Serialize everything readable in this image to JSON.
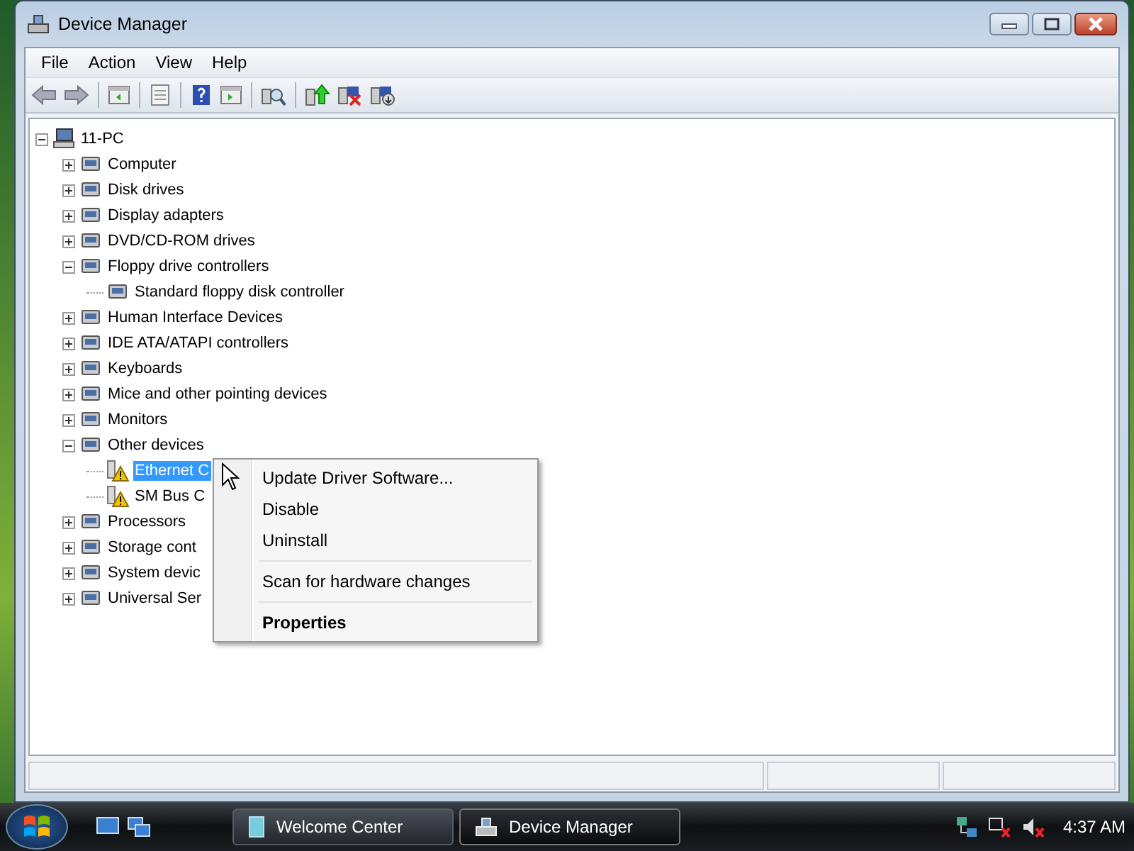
{
  "window": {
    "title": "Device Manager"
  },
  "menubar": [
    "File",
    "Action",
    "View",
    "Help"
  ],
  "tree": {
    "label": "11-PC",
    "expanded": true,
    "selected": false,
    "problem": false,
    "children": [
      {
        "label": "Computer",
        "expanded": false,
        "selected": false,
        "problem": false
      },
      {
        "label": "Disk drives",
        "expanded": false,
        "selected": false,
        "problem": false
      },
      {
        "label": "Display adapters",
        "expanded": false,
        "selected": false,
        "problem": false
      },
      {
        "label": "DVD/CD-ROM drives",
        "expanded": false,
        "selected": false,
        "problem": false
      },
      {
        "label": "Floppy drive controllers",
        "expanded": true,
        "selected": false,
        "problem": false,
        "children": [
          {
            "label": "Standard floppy disk controller",
            "selected": false,
            "problem": false
          }
        ]
      },
      {
        "label": "Human Interface Devices",
        "expanded": false,
        "selected": false,
        "problem": false
      },
      {
        "label": "IDE ATA/ATAPI controllers",
        "expanded": false,
        "selected": false,
        "problem": false
      },
      {
        "label": "Keyboards",
        "expanded": false,
        "selected": false,
        "problem": false
      },
      {
        "label": "Mice and other pointing devices",
        "expanded": false,
        "selected": false,
        "problem": false
      },
      {
        "label": "Monitors",
        "expanded": false,
        "selected": false,
        "problem": false
      },
      {
        "label": "Other devices",
        "expanded": true,
        "selected": false,
        "problem": false,
        "children": [
          {
            "label": "Ethernet C",
            "selected": true,
            "problem": true
          },
          {
            "label": "SM Bus C",
            "selected": false,
            "problem": true
          }
        ]
      },
      {
        "label": "Processors",
        "expanded": false,
        "selected": false,
        "problem": false
      },
      {
        "label": "Storage cont",
        "expanded": false,
        "selected": false,
        "problem": false
      },
      {
        "label": "System devic",
        "expanded": false,
        "selected": false,
        "problem": false
      },
      {
        "label": "Universal Ser",
        "expanded": false,
        "selected": false,
        "problem": false
      }
    ]
  },
  "context_menu": {
    "groups": [
      [
        {
          "label": "Update Driver Software...",
          "default": false
        },
        {
          "label": "Disable",
          "default": false
        },
        {
          "label": "Uninstall",
          "default": false
        }
      ],
      [
        {
          "label": "Scan for hardware changes",
          "default": false
        }
      ],
      [
        {
          "label": "Properties",
          "default": true
        }
      ]
    ]
  },
  "taskbar": {
    "tasks": [
      {
        "label": "Welcome Center",
        "selected": false
      },
      {
        "label": "Device Manager",
        "selected": true
      }
    ],
    "clock": "4:37 AM"
  }
}
